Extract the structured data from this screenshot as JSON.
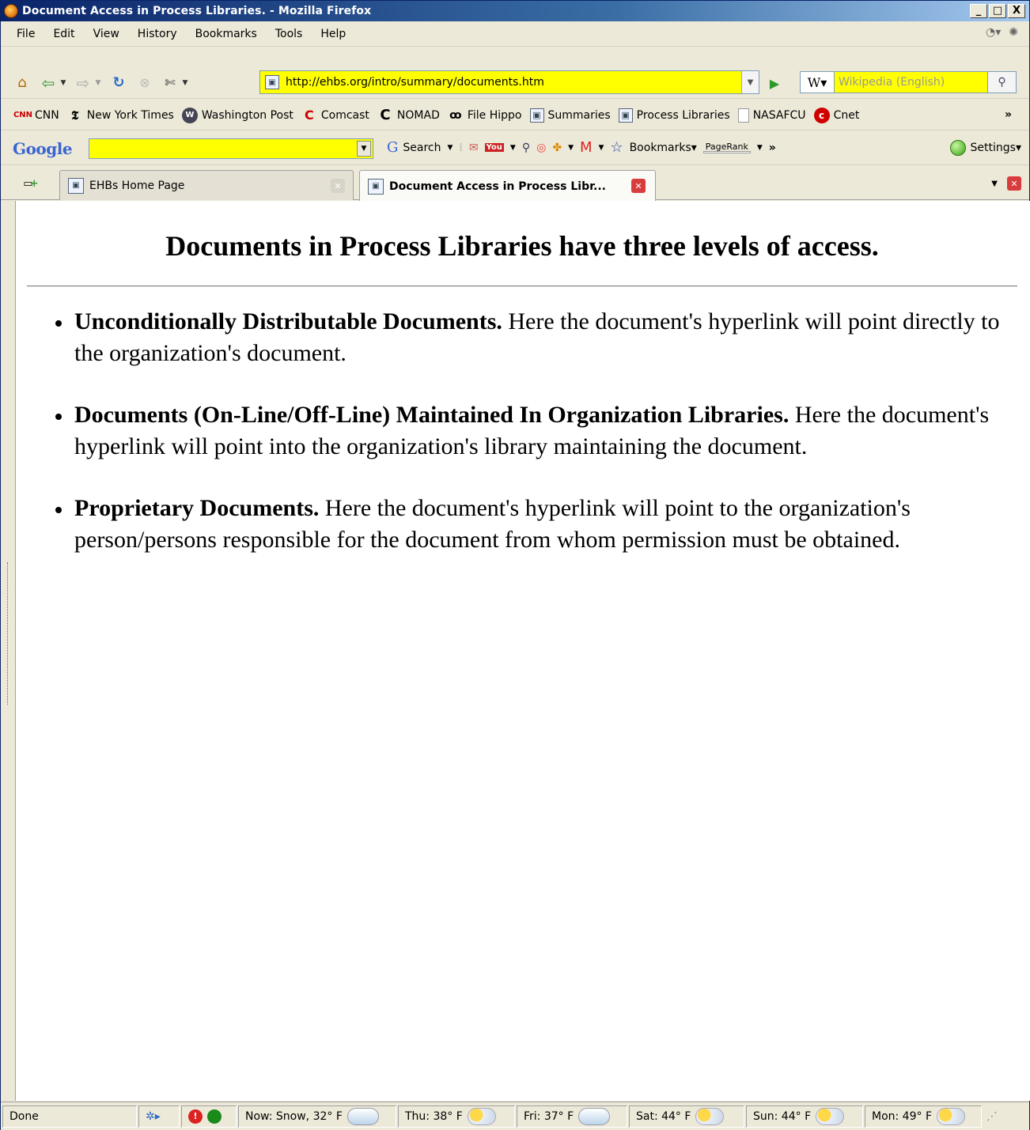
{
  "window": {
    "title": "Document Access in Process Libraries. - Mozilla Firefox",
    "min": "_",
    "max": "□",
    "close": "X"
  },
  "menu": [
    "File",
    "Edit",
    "View",
    "History",
    "Bookmarks",
    "Tools",
    "Help"
  ],
  "nav": {
    "url": "http://ehbs.org/intro/summary/documents.htm",
    "search_engine": "Wikipedia (English)"
  },
  "bookmarks": [
    {
      "label": "CNN",
      "icon": "cnn-icon"
    },
    {
      "label": "New York Times",
      "icon": "nyt-icon"
    },
    {
      "label": "Washington Post",
      "icon": "wapo-icon"
    },
    {
      "label": "Comcast",
      "icon": "comcast-icon"
    },
    {
      "label": "NOMAD",
      "icon": "nomad-icon"
    },
    {
      "label": "File Hippo",
      "icon": "filehippo-icon"
    },
    {
      "label": "Summaries",
      "icon": "page-icon"
    },
    {
      "label": "Process Libraries",
      "icon": "page-icon"
    },
    {
      "label": "NASAFCU",
      "icon": "blank-page-icon"
    },
    {
      "label": "Cnet",
      "icon": "cnet-icon"
    }
  ],
  "bookmarks_more": "»",
  "google_bar": {
    "logo": "Google",
    "search_label": "Search",
    "bookmarks_label": "Bookmarks",
    "pagerank_label": "PageRank",
    "settings_label": "Settings",
    "more": "»"
  },
  "tabs": [
    {
      "label": "EHBs Home Page",
      "active": false
    },
    {
      "label": "Document Access in Process Libr...",
      "active": true
    }
  ],
  "page": {
    "heading": "Documents in Process Libraries have three levels of access.",
    "items": [
      {
        "bold": "Unconditionally Distributable Documents.",
        "text": " Here the document's hyperlink will point directly to the organization's document."
      },
      {
        "bold": "Documents (On-Line/Off-Line) Maintained In Organization Libraries.",
        "text": " Here the document's hyperlink will point into the organization's library maintaining the document."
      },
      {
        "bold": "Proprietary Documents.",
        "text": " Here the document's hyperlink will point to the organization's person/persons responsible for the document from whom permission must be obtained."
      }
    ]
  },
  "status": {
    "text": "Done",
    "weather": [
      {
        "label": "Now: Snow, 32° F",
        "icon": "snow-cloud-icon"
      },
      {
        "label": "Thu: 38° F",
        "icon": "partly-sunny-icon"
      },
      {
        "label": "Fri: 37° F",
        "icon": "rain-cloud-icon"
      },
      {
        "label": "Sat: 44° F",
        "icon": "partly-sunny-icon"
      },
      {
        "label": "Sun: 44° F",
        "icon": "partly-sunny-icon"
      },
      {
        "label": "Mon: 49° F",
        "icon": "partly-sunny-icon"
      }
    ]
  }
}
